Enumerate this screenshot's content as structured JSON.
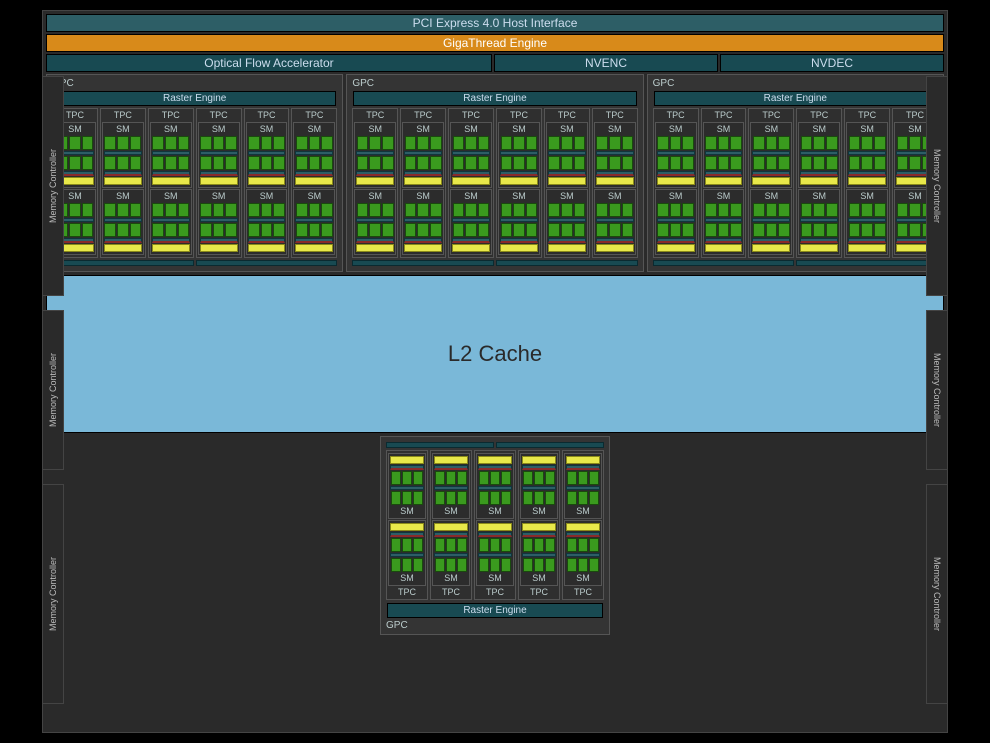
{
  "pci": "PCI Express 4.0 Host Interface",
  "giga": "GigaThread Engine",
  "ofa": "Optical Flow Accelerator",
  "nvenc": "NVENC",
  "nvdec": "NVDEC",
  "gpc": "GPC",
  "raster": "Raster Engine",
  "tpc": "TPC",
  "sm": "SM",
  "l2": "L2 Cache",
  "mc": "Memory Controller",
  "top_gpc_count": 3,
  "tpc_per_top_gpc": 6,
  "sm_per_tpc": 2,
  "bottom_tpc_count": 5
}
